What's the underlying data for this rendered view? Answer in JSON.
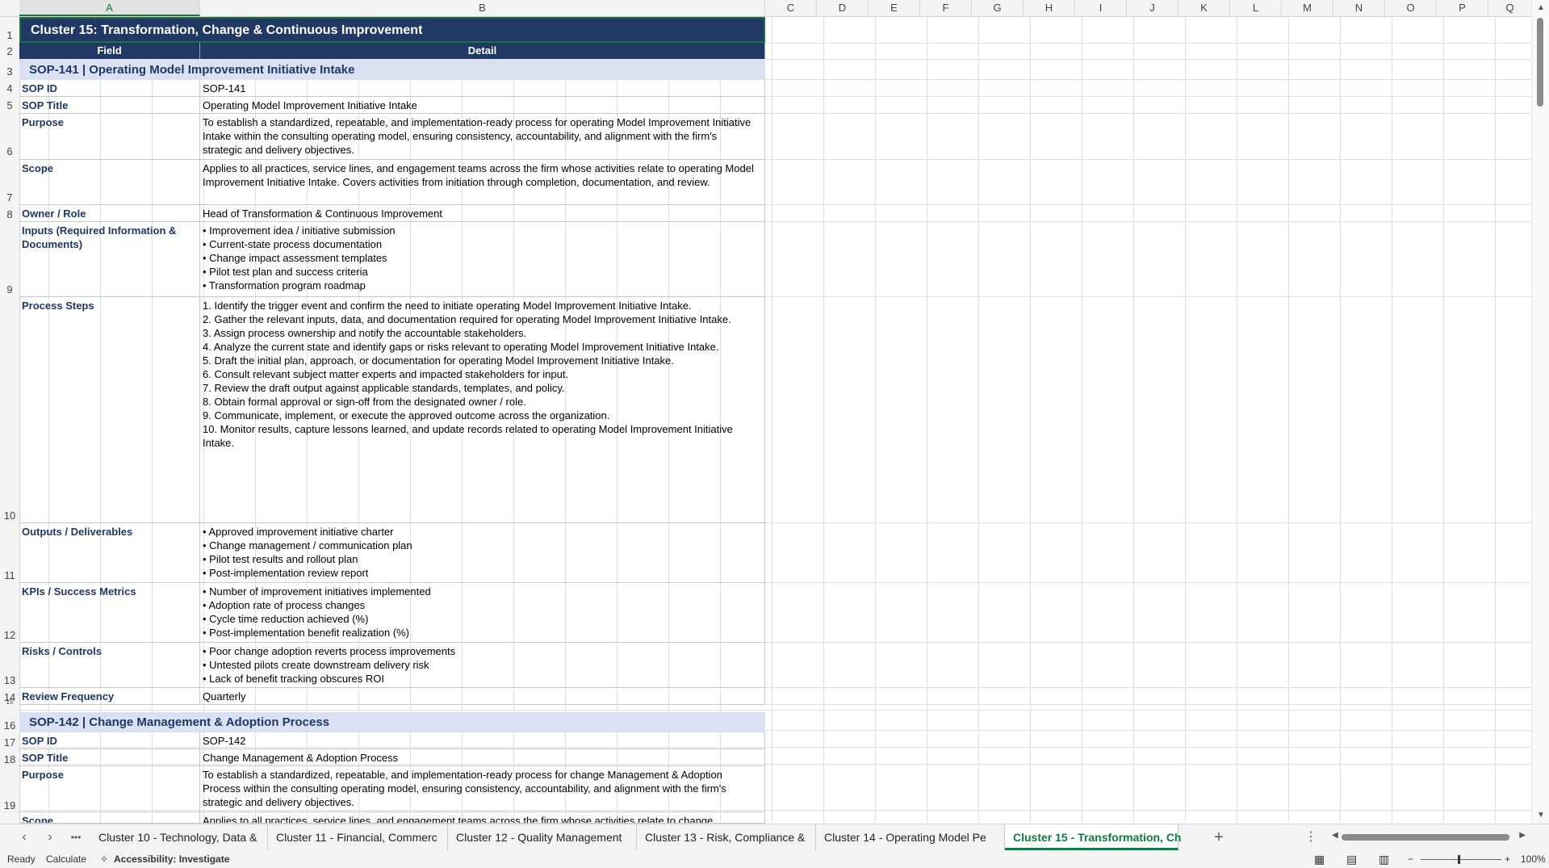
{
  "columns": [
    "A",
    "B",
    "C",
    "D",
    "E",
    "F",
    "G",
    "H",
    "I",
    "J",
    "K",
    "L",
    "M",
    "N",
    "O",
    "P",
    "Q"
  ],
  "title": "Cluster 15: Transformation, Change & Continuous Improvement",
  "headers": {
    "field": "Field",
    "detail": "Detail"
  },
  "rows": {
    "r1": "1",
    "r2": "2",
    "r3": "3",
    "r4": "4",
    "r5": "5",
    "r6": "6",
    "r7": "7",
    "r8": "8",
    "r9": "9",
    "r10": "10",
    "r11": "11",
    "r12": "12",
    "r13": "13",
    "r14": "14",
    "r15": "15",
    "r16": "16",
    "r17": "17",
    "r18": "18",
    "r19": "19"
  },
  "sop141": {
    "section": "SOP-141  |  Operating Model Improvement Initiative Intake",
    "id_label": "SOP ID",
    "id": "SOP-141",
    "title_label": "SOP Title",
    "title": "Operating Model Improvement Initiative Intake",
    "purpose_label": "Purpose",
    "purpose": "To establish a standardized, repeatable, and implementation-ready process for operating Model Improvement Initiative\nIntake within the consulting operating model, ensuring consistency, accountability, and alignment with the firm's\nstrategic and delivery objectives.",
    "scope_label": "Scope",
    "scope": "Applies to all practices, service lines, and engagement teams across the firm whose activities relate to operating Model\nImprovement Initiative Intake. Covers activities from initiation through completion, documentation, and review.",
    "owner_label": "Owner / Role",
    "owner": "Head of Transformation & Continuous Improvement",
    "inputs_label": "Inputs (Required Information &\nDocuments)",
    "inputs": "• Improvement idea / initiative submission\n• Current-state process documentation\n• Change impact assessment templates\n• Pilot test plan and success criteria\n• Transformation program roadmap",
    "steps_label": "Process Steps",
    "steps": "1. Identify the trigger event and confirm the need to initiate operating Model Improvement Initiative Intake.\n2. Gather the relevant inputs, data, and documentation required for operating Model Improvement Initiative Intake.\n3. Assign process ownership and notify the accountable stakeholders.\n4. Analyze the current state and identify gaps or risks relevant to operating Model Improvement Initiative Intake.\n5. Draft the initial plan, approach, or documentation for operating Model Improvement Initiative Intake.\n6. Consult relevant subject matter experts and impacted stakeholders for input.\n7. Review the draft output against applicable standards, templates, and policy.\n8. Obtain formal approval or sign-off from the designated owner / role.\n9. Communicate, implement, or execute the approved outcome across the organization.\n10. Monitor results, capture lessons learned, and update records related to operating Model Improvement Initiative\nIntake.",
    "outputs_label": "Outputs / Deliverables",
    "outputs": "• Approved improvement initiative charter\n• Change management / communication plan\n• Pilot test results and rollout plan\n• Post-implementation review report",
    "kpis_label": "KPIs / Success Metrics",
    "kpis": "• Number of improvement initiatives implemented\n• Adoption rate of process changes\n• Cycle time reduction achieved (%)\n• Post-implementation benefit realization (%)",
    "risks_label": "Risks / Controls",
    "risks": "• Poor change adoption reverts process improvements\n• Untested pilots create downstream delivery risk\n• Lack of benefit tracking obscures ROI",
    "review_label": "Review Frequency",
    "review": "Quarterly"
  },
  "sop142": {
    "section": "SOP-142  |  Change Management & Adoption Process",
    "id_label": "SOP ID",
    "id": "SOP-142",
    "title_label": "SOP Title",
    "title": "Change Management & Adoption Process",
    "purpose_label": "Purpose",
    "purpose": "To establish a standardized, repeatable, and implementation-ready process for change Management & Adoption\nProcess within the consulting operating model, ensuring consistency, accountability, and alignment with the firm's\nstrategic and delivery objectives.",
    "scope_label": "Scope",
    "scope": "Applies to all practices, service lines, and engagement teams across the firm whose activities relate to change"
  },
  "tabs": [
    "Cluster 10 - Technology, Data &",
    "Cluster 11 - Financial, Commerc",
    "Cluster 12 - Quality Management",
    "Cluster 13 - Risk, Compliance &",
    "Cluster 14 - Operating Model Pe",
    "Cluster 15 - Transformation, Ch"
  ],
  "status": {
    "ready": "Ready",
    "calculate": "Calculate",
    "accessibility": "Accessibility: Investigate",
    "zoom": "100%"
  },
  "icons": {
    "add_sheet": "+",
    "more_tabs": "•••",
    "more": "⋮"
  }
}
